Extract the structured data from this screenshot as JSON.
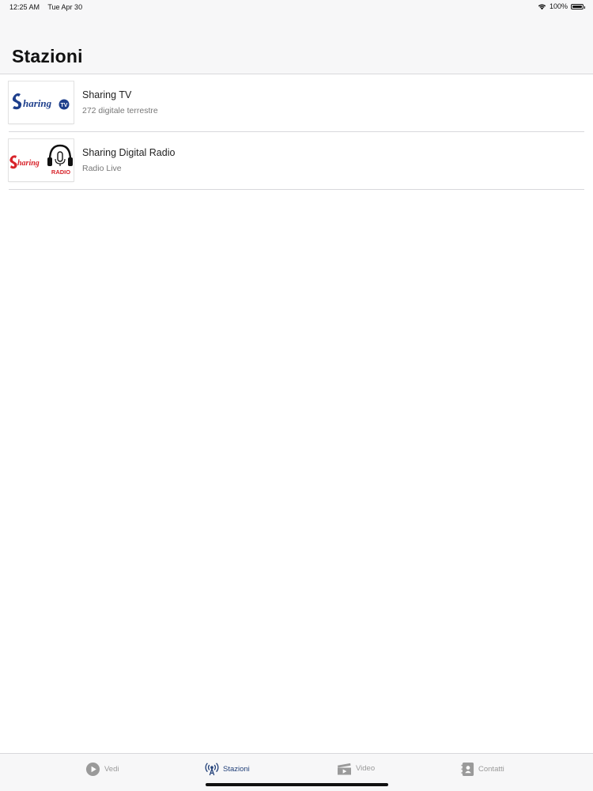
{
  "status_bar": {
    "time": "12:25 AM",
    "date": "Tue Apr 30",
    "battery": "100%",
    "battery_level": 1.0
  },
  "header": {
    "title": "Stazioni"
  },
  "stations": [
    {
      "name": "Sharing TV",
      "subtitle": "272 digitale terrestre",
      "logo": {
        "icon": "sharing-tv-logo",
        "text": "Sharing",
        "badge": "TV",
        "color": "#1e3f8c"
      }
    },
    {
      "name": "Sharing Digital Radio",
      "subtitle": "Radio Live",
      "logo": {
        "icon": "sharing-radio-logo",
        "text": "Sharing",
        "badge": "RADIO",
        "color": "#d8232a"
      }
    }
  ],
  "tabs": [
    {
      "label": "Vedi",
      "icon": "play-circle-icon",
      "active": false
    },
    {
      "label": "Stazioni",
      "icon": "broadcast-icon",
      "active": true
    },
    {
      "label": "Video",
      "icon": "clapperboard-icon",
      "active": false
    },
    {
      "label": "Contatti",
      "icon": "contacts-book-icon",
      "active": false
    }
  ],
  "colors": {
    "active_tab": "#24427a",
    "inactive_tab": "#9a9a9a",
    "bar_background": "#f7f7f8"
  }
}
